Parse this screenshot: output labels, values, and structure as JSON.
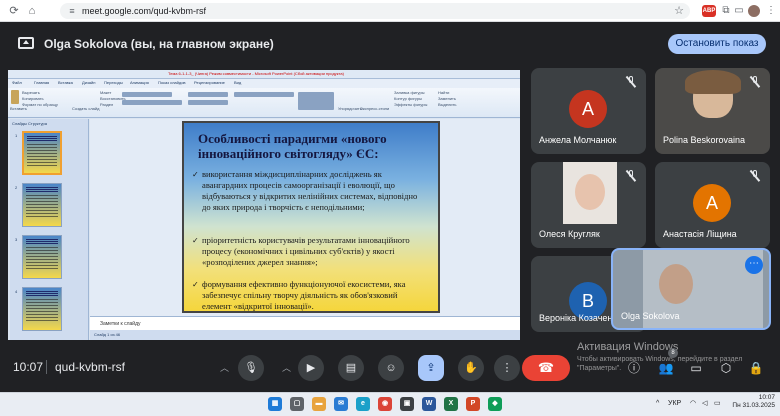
{
  "browser": {
    "url": "meet.google.com/qud-kvbm-rsf",
    "extension_badge": "ABP"
  },
  "banner": {
    "text": "Olga Sokolova (вы, на главном экране)",
    "stop_button": "Остановить показ"
  },
  "ppt": {
    "window_title": "Тема 6-1-1-3_ (Чинга) Режим совместимости - Microsoft PowerPoint (Сбой активации продукта)",
    "tabs": [
      "Файл",
      "Главная",
      "Вставка",
      "Дизайн",
      "Переходы",
      "Анимация",
      "Показ слайдов",
      "Рецензирование",
      "Вид"
    ],
    "pane_tabs": "Слайды   Структура",
    "notes_placeholder": "Заметки к слайду",
    "status": "Слайд 1 из 46",
    "ribbon_labels": {
      "paste": "Вставить",
      "cut": "Вырезать",
      "copy": "Копировать",
      "format": "Формат по образцу",
      "new_slide": "Создать слайд",
      "layout": "Макет",
      "reset": "Восстановить",
      "section": "Раздел",
      "arrange": "Упорядочить",
      "quick_styles": "Экспресс-стили",
      "fill": "Заливка фигуры",
      "outline": "Контур фигуры",
      "effects": "Эффекты фигуры",
      "find": "Найти",
      "replace": "Заменить",
      "select": "Выделить"
    },
    "thumbs": [
      "1",
      "2",
      "3",
      "4"
    ],
    "slide": {
      "title": "Особливості парадигми «нового інноваційного світогляду» ЄС:",
      "bullets": [
        "використання міждисциплінарних досліджень як авангардних процесів самоорганізації і еволюції, що відбуваються у відкритих нелінійних системах, відповідно до яких природа і творчість є неподільними;",
        "пріоритетність користувачів результатами інноваційного процесу (економічних і цивільних суб'єктів) у якості «розподілених джерел знання»;",
        "формування ефективно функціонуючої екосистеми, яка забезпечує спільну творчу діяльність як обов'язковий елемент «відкритої інновації»."
      ]
    }
  },
  "participants": [
    {
      "name": "Анжела Молчанюк",
      "initial": "А",
      "color": "#c5351f",
      "muted": true
    },
    {
      "name": "Polina Beskorovaina",
      "initial": "",
      "color": "",
      "muted": true
    },
    {
      "name": "Олеся Кругляк",
      "initial": "",
      "color": "",
      "muted": true
    },
    {
      "name": "Анастасія Ліщина",
      "initial": "А",
      "color": "#e37400",
      "muted": true
    },
    {
      "name": "Вероніка Козаченко",
      "initial": "В",
      "color": "#1e62b0",
      "muted": false
    }
  ],
  "self_tile": {
    "name": "Olga Sokolova",
    "more_icon": "⋯"
  },
  "callbar": {
    "time": "10:07",
    "meeting_code": "qud-kvbm-rsf",
    "participant_count": "8"
  },
  "watermark": {
    "title": "Активация Windows",
    "line1": "Чтобы активировать Windows, перейдите в раздел",
    "line2": "\"Параметры\"."
  },
  "taskbar": {
    "language": "УКР",
    "time": "10:07",
    "date": "Пн 31.03.2025"
  }
}
